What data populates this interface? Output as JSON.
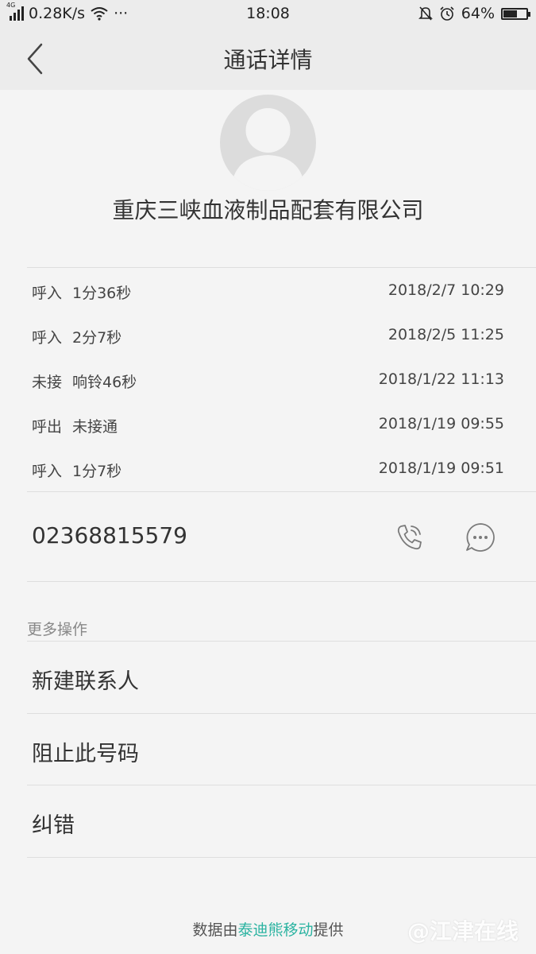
{
  "status_bar": {
    "network_type": "4G",
    "speed": "0.28K/s",
    "more": "···",
    "time": "18:08",
    "battery_percent_text": "64%",
    "battery_level": 0.64
  },
  "header": {
    "title": "通话详情"
  },
  "contact": {
    "name": "重庆三峡血液制品配套有限公司",
    "phone_number": "02368815579"
  },
  "call_log": [
    {
      "type": "呼入",
      "detail": "1分36秒",
      "datetime": "2018/2/7 10:29"
    },
    {
      "type": "呼入",
      "detail": "2分7秒",
      "datetime": "2018/2/5 11:25"
    },
    {
      "type": "未接",
      "detail": "响铃46秒",
      "datetime": "2018/1/22 11:13"
    },
    {
      "type": "呼出",
      "detail": "未接通",
      "datetime": "2018/1/19 09:55"
    },
    {
      "type": "呼入",
      "detail": "1分7秒",
      "datetime": "2018/1/19 09:51"
    }
  ],
  "more_actions": {
    "label": "更多操作",
    "items": [
      {
        "label": "新建联系人"
      },
      {
        "label": "阻止此号码"
      },
      {
        "label": "纠错"
      }
    ]
  },
  "footer": {
    "prefix": "数据由",
    "brand": "泰迪熊移动",
    "suffix": "提供",
    "watermark": "@江津在线"
  },
  "colors": {
    "background": "#f4f4f4",
    "header_background": "#ececec",
    "brand_accent": "#2bb3a1",
    "icon_gray": "#7a7a7a"
  },
  "icons": [
    "back-chevron-icon",
    "phone-call-icon",
    "message-bubble-icon",
    "avatar-placeholder-icon",
    "wifi-icon",
    "silent-bell-icon",
    "alarm-clock-icon",
    "battery-icon"
  ]
}
